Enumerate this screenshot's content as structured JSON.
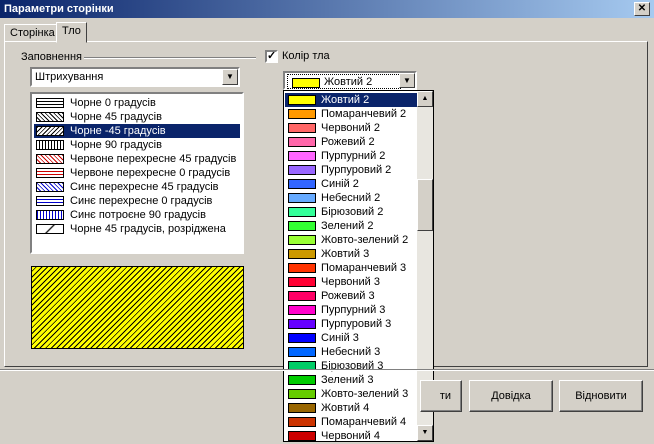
{
  "window": {
    "title": "Параметри сторінки",
    "close_glyph": "✕"
  },
  "tabs": [
    {
      "label": "Сторінка"
    },
    {
      "label": "Тло"
    }
  ],
  "fill": {
    "group_label": "Заповнення",
    "type_value": "Штрихування",
    "patterns": [
      {
        "label": "Чорне 0 градусів"
      },
      {
        "label": "Чорне 45 градусів"
      },
      {
        "label": "Чорне -45 градусів"
      },
      {
        "label": "Чорне 90 градусів"
      },
      {
        "label": "Червоне перехресне 45 градусів"
      },
      {
        "label": "Червоне перехресне 0 градусів"
      },
      {
        "label": "Синє перехресне 45 градусів"
      },
      {
        "label": "Синє перехресне 0 градусів"
      },
      {
        "label": "Синє потроєне 90 градусів"
      },
      {
        "label": "Чорне 45 градусів, розріджена"
      }
    ],
    "selected_pattern": "Чорне -45 градусів"
  },
  "background_color": {
    "checkbox_label": "Колір тла",
    "checked": true,
    "selected": "Жовтий 2",
    "selected_color": "#ffff00",
    "options": [
      {
        "label": "Жовтий 2",
        "color": "#ffff00"
      },
      {
        "label": "Помаранчевий 2",
        "color": "#ff9900"
      },
      {
        "label": "Червоний 2",
        "color": "#ff6666"
      },
      {
        "label": "Рожевий 2",
        "color": "#ff66aa"
      },
      {
        "label": "Пурпурний 2",
        "color": "#ff66ff"
      },
      {
        "label": "Пурпуровий 2",
        "color": "#9966ff"
      },
      {
        "label": "Синій 2",
        "color": "#3366ff"
      },
      {
        "label": "Небесний 2",
        "color": "#66aaff"
      },
      {
        "label": "Бірюзовий 2",
        "color": "#33ff99"
      },
      {
        "label": "Зелений 2",
        "color": "#33ff33"
      },
      {
        "label": "Жовто-зелений 2",
        "color": "#99ff33"
      },
      {
        "label": "Жовтий 3",
        "color": "#cc9900"
      },
      {
        "label": "Помаранчевий 3",
        "color": "#ff3300"
      },
      {
        "label": "Червоний 3",
        "color": "#ff0033"
      },
      {
        "label": "Рожевий 3",
        "color": "#ff0066"
      },
      {
        "label": "Пурпурний 3",
        "color": "#ff00cc"
      },
      {
        "label": "Пурпуровий 3",
        "color": "#6600ff"
      },
      {
        "label": "Синій 3",
        "color": "#0000ff"
      },
      {
        "label": "Небесний 3",
        "color": "#0066ff"
      },
      {
        "label": "Бірюзовий 3",
        "color": "#00cc66"
      },
      {
        "label": "Зелений 3",
        "color": "#00cc00"
      },
      {
        "label": "Жовто-зелений 3",
        "color": "#66cc00"
      },
      {
        "label": "Жовтий 4",
        "color": "#996600"
      },
      {
        "label": "Помаранчевий 4",
        "color": "#cc3300"
      },
      {
        "label": "Червоний 4",
        "color": "#cc0000"
      }
    ]
  },
  "buttons": {
    "ok_partial": "ти",
    "help": "Довідка",
    "reset": "Відновити"
  }
}
